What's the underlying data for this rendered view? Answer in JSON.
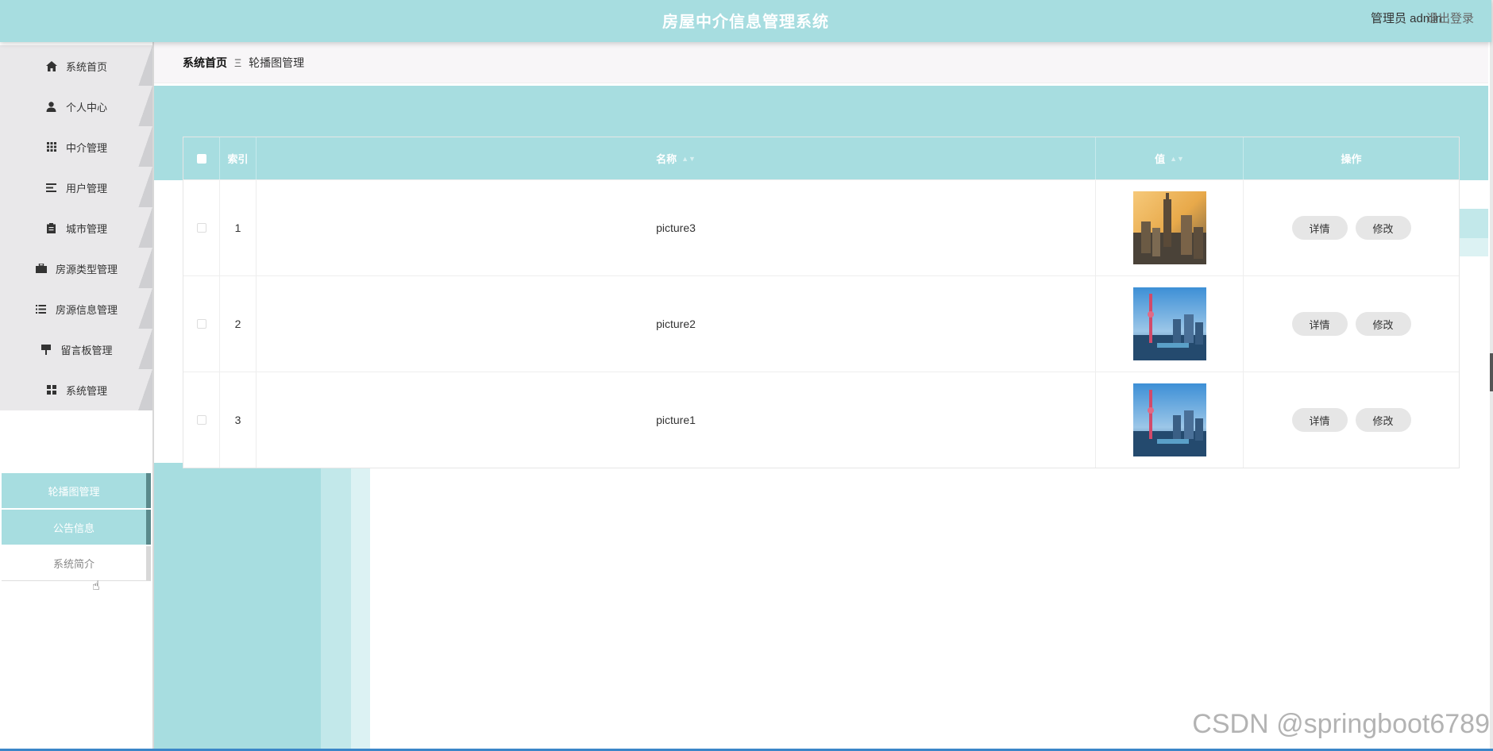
{
  "header": {
    "title": "房屋中介信息管理系统",
    "user": "管理员 admin",
    "logout": "退出登录"
  },
  "sidebar": {
    "items": [
      {
        "label": "系统首页",
        "icon": "home-icon"
      },
      {
        "label": "个人中心",
        "icon": "user-icon"
      },
      {
        "label": "中介管理",
        "icon": "grid-icon"
      },
      {
        "label": "用户管理",
        "icon": "list-icon"
      },
      {
        "label": "城市管理",
        "icon": "clipboard-icon"
      },
      {
        "label": "房源类型管理",
        "icon": "briefcase-icon"
      },
      {
        "label": "房源信息管理",
        "icon": "menu-icon"
      },
      {
        "label": "留言板管理",
        "icon": "sign-icon"
      },
      {
        "label": "系统管理",
        "icon": "apps-icon"
      }
    ],
    "subitems": [
      "轮播图管理",
      "公告信息",
      "系统简介"
    ]
  },
  "breadcrumb": {
    "home": "系统首页",
    "separator": "Ξ",
    "current": "轮播图管理"
  },
  "table": {
    "headers": {
      "index": "索引",
      "name": "名称",
      "value": "值",
      "actions": "操作"
    },
    "rows": [
      {
        "index": "1",
        "name": "picture3",
        "detail": "详情",
        "edit": "修改"
      },
      {
        "index": "2",
        "name": "picture2",
        "detail": "详情",
        "edit": "修改"
      },
      {
        "index": "3",
        "name": "picture1",
        "detail": "详情",
        "edit": "修改"
      }
    ]
  },
  "watermark": "CSDN @springboot6789",
  "colors": {
    "accent": "#a7dde0",
    "nav_bg": "#e9e8ea",
    "button_bg": "#e6e6e6"
  }
}
